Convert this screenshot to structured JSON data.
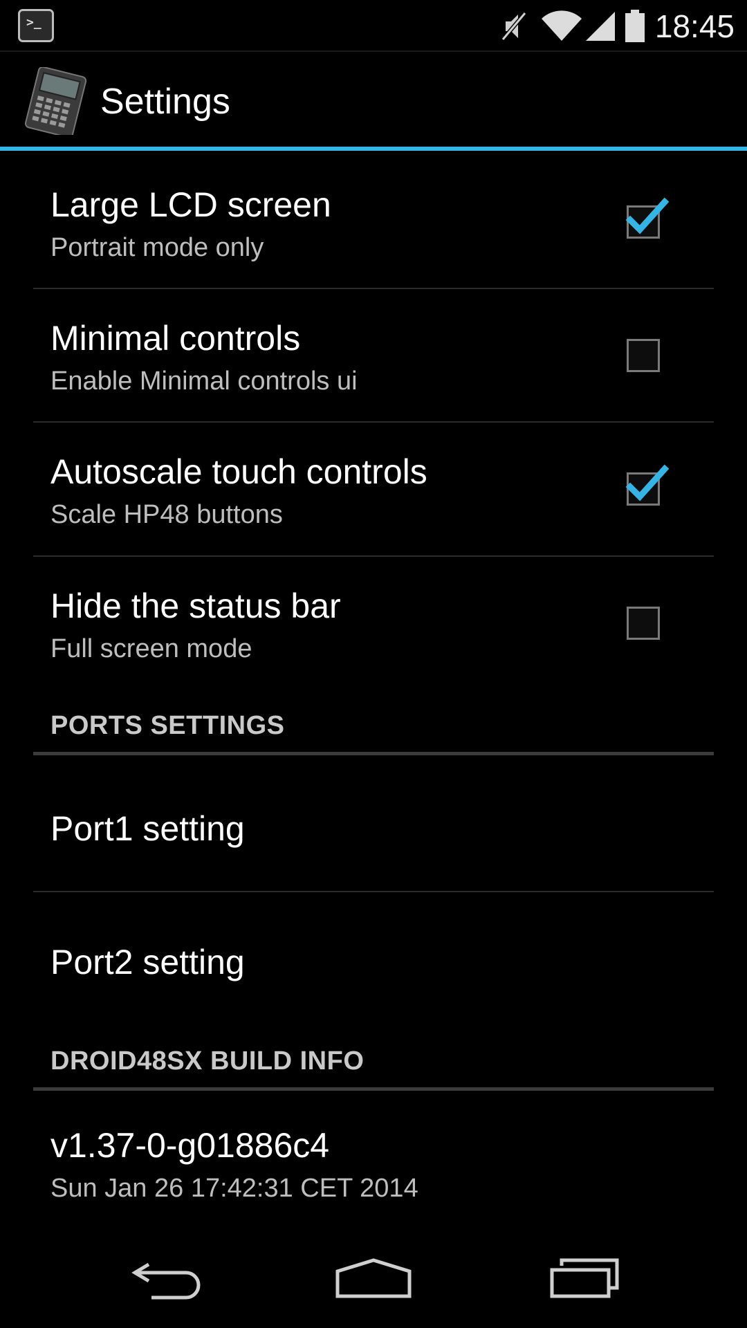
{
  "status_bar": {
    "app_icon": "terminal-icon",
    "icons": [
      "mute-icon",
      "wifi-icon",
      "signal-icon",
      "battery-icon"
    ],
    "time": "18:45"
  },
  "action_bar": {
    "logo_icon": "calculator-icon",
    "title": "Settings",
    "accent_color": "#33b5e5"
  },
  "preferences": [
    {
      "title": "Large LCD screen",
      "summary": "Portrait mode only",
      "checked": true
    },
    {
      "title": "Minimal controls",
      "summary": "Enable Minimal controls ui",
      "checked": false
    },
    {
      "title": "Autoscale touch controls",
      "summary": "Scale HP48 buttons",
      "checked": true
    },
    {
      "title": "Hide the status bar",
      "summary": "Full screen mode",
      "checked": false
    }
  ],
  "ports_section": {
    "header": "PORTS SETTINGS",
    "items": [
      {
        "title": "Port1 setting"
      },
      {
        "title": "Port2 setting"
      }
    ]
  },
  "build_section": {
    "header": "DROID48SX BUILD INFO",
    "version": "v1.37-0-g01886c4",
    "date": "Sun Jan 26 17:42:31 CET 2014"
  },
  "nav_bar": {
    "icons": [
      "back-icon",
      "home-icon",
      "recents-icon"
    ]
  }
}
